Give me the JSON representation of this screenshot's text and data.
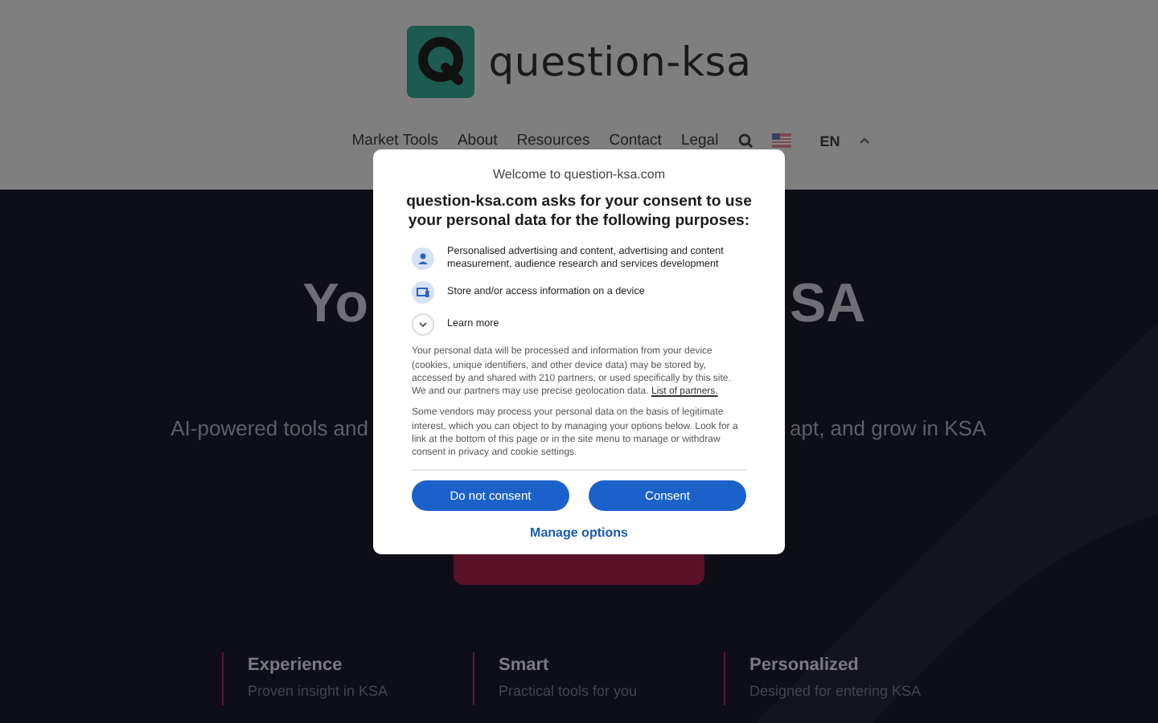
{
  "header": {
    "brand": "question-ksa",
    "nav": [
      {
        "label": "Market Tools"
      },
      {
        "label": "About"
      },
      {
        "label": "Resources"
      },
      {
        "label": "Contact"
      },
      {
        "label": "Legal"
      }
    ],
    "language": "EN"
  },
  "hero": {
    "title_parts": [
      "Yo",
      "SA"
    ],
    "subtitle_parts": [
      "AI-powered tools and",
      "apt, and grow in KSA"
    ]
  },
  "features": [
    {
      "title": "Experience",
      "subtitle": "Proven insight in KSA"
    },
    {
      "title": "Smart",
      "subtitle": "Practical tools for you"
    },
    {
      "title": "Personalized",
      "subtitle": "Designed for entering KSA"
    }
  ],
  "consent": {
    "welcome": "Welcome to question-ksa.com",
    "heading": "question-ksa.com asks for your consent to use your personal data for the following purposes:",
    "purposes": [
      {
        "kind": "person",
        "label": "Personalised advertising and content, advertising and content measurement, audience research and services development"
      },
      {
        "kind": "device",
        "label": "Store and/or access information on a device"
      }
    ],
    "learn_more": "Learn more",
    "body": "Your personal data will be processed and information from your device (cookies, unique identifiers, and other device data) may be stored by, accessed by and shared with 210 partners, or used specifically by this site. We and our partners may use precise geolocation data.",
    "partners_link": "List of partners.",
    "vendors": "Some vendors may process your personal data on the basis of legitimate interest, which you can object to by managing your options below. Look for a link at the bottom of this page or in the site menu to manage or withdraw consent in privacy and cookie settings.",
    "buttons": [
      "Do not consent",
      "Consent"
    ],
    "manage": "Manage options"
  }
}
